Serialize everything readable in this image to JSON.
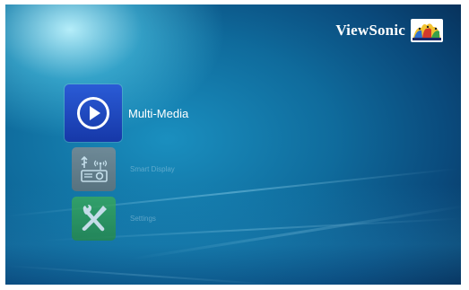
{
  "brand": {
    "name": "ViewSonic",
    "logo_icon": "viewsonic-birds-logo"
  },
  "menu": {
    "items": [
      {
        "label": "Multi-Media",
        "icon": "play-icon",
        "color": "#1f47c4",
        "selected": true
      },
      {
        "label": "Smart Display",
        "icon": "projector-wireless-icon",
        "color": "#808183",
        "selected": false
      },
      {
        "label": "Settings",
        "icon": "wrench-screwdriver-icon",
        "color": "#2f9c4b",
        "selected": false
      }
    ]
  },
  "colors": {
    "background_deep": "#06284c",
    "background_mid": "#0f6b9c",
    "text_primary": "#ffffff"
  }
}
